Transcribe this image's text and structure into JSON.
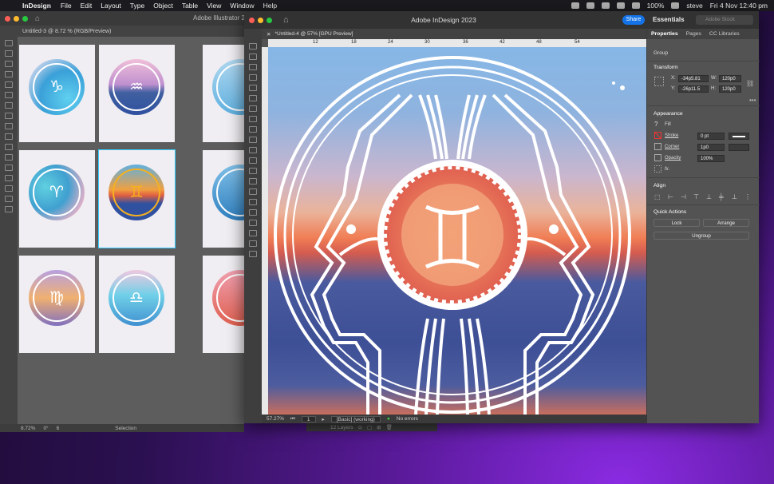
{
  "menubar": {
    "app": "InDesign",
    "items": [
      "File",
      "Edit",
      "Layout",
      "Type",
      "Object",
      "Table",
      "View",
      "Window",
      "Help"
    ],
    "battery": "100%",
    "user": "steve",
    "clock": "Fri 4 Nov  12:40 pm"
  },
  "illustrator": {
    "title": "Adobe Illustrator 20",
    "tab": "Untitled-3 @ 8.72 % (RGB/Preview)",
    "zoom": "8.72%",
    "rotate": "0°",
    "artboard": "6",
    "tool": "Selection",
    "layers": "12 Layers",
    "signs": [
      "♑",
      "♒",
      "♈",
      "♉",
      "♊",
      "♋",
      "♍",
      "♎",
      "♌"
    ]
  },
  "indesign": {
    "title": "Adobe InDesign 2023",
    "share": "Share",
    "workspace": "Essentials",
    "stock_placeholder": "Adobe Stock",
    "tab": "*Untitled-4 @ 57% [GPU Preview]",
    "ruler_marks": [
      "12",
      "18",
      "24",
      "30",
      "36",
      "42",
      "48",
      "54"
    ],
    "status": {
      "zoom": "57.27%",
      "page": "1",
      "style": "[Basic] (working)",
      "errors": "No errors"
    }
  },
  "panel": {
    "tabs": [
      "Properties",
      "Pages",
      "CC Libraries"
    ],
    "group": "Group",
    "transform": "Transform",
    "x_label": "X:",
    "x": "-34p5.81",
    "y_label": "Y:",
    "y": "-26p11.5",
    "w_label": "W:",
    "w": "120p0",
    "h_label": "H:",
    "h": "120p0",
    "appearance": "Appearance",
    "fill": "Fill",
    "stroke": "Stroke",
    "stroke_val": "0 pt",
    "corner": "Corner",
    "corner_val": "1p0",
    "opacity": "Opacity",
    "opacity_val": "100%",
    "fx": "fx.",
    "align": "Align",
    "quick": "Quick Actions",
    "lock": "Lock",
    "arrange": "Arrange",
    "ungroup": "Ungroup"
  }
}
